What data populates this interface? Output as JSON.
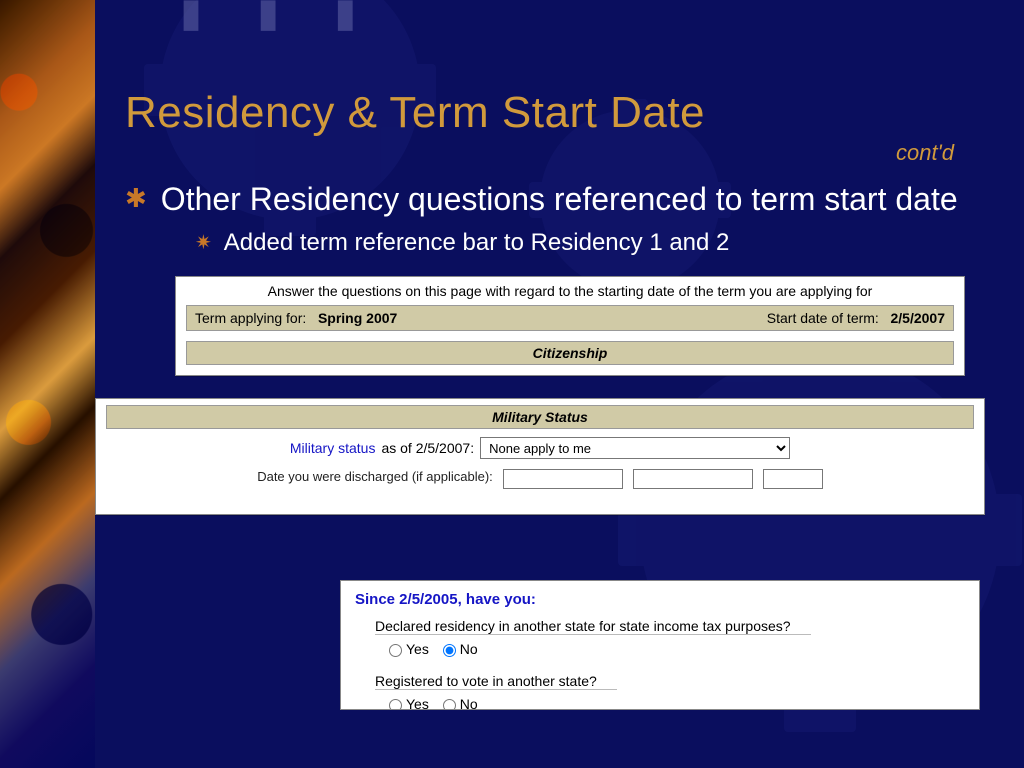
{
  "slide": {
    "title": "Residency & Term Start Date",
    "contd": "cont'd",
    "bullet1": "Other Residency questions referenced to term start date",
    "bullet2": "Added term reference bar to Residency 1 and 2"
  },
  "panel1": {
    "instruction": "Answer the questions on this page with regard to the starting date of the term you are applying for",
    "term_label": "Term applying for:",
    "term_value": "Spring 2007",
    "start_label": "Start date of term:",
    "start_value": "2/5/2007",
    "section": "Citizenship"
  },
  "panel2": {
    "section": "Military Status",
    "link": "Military status",
    "asof": " as of 2/5/2007:",
    "selected": "None apply to me",
    "row2_label": "Date you were discharged (if applicable):"
  },
  "panel3": {
    "since": "Since 2/5/2005, have you:",
    "q1": "Declared residency in another state for state income tax purposes?",
    "q2": "Registered to vote in another state?",
    "yes": "Yes",
    "no": "No"
  }
}
